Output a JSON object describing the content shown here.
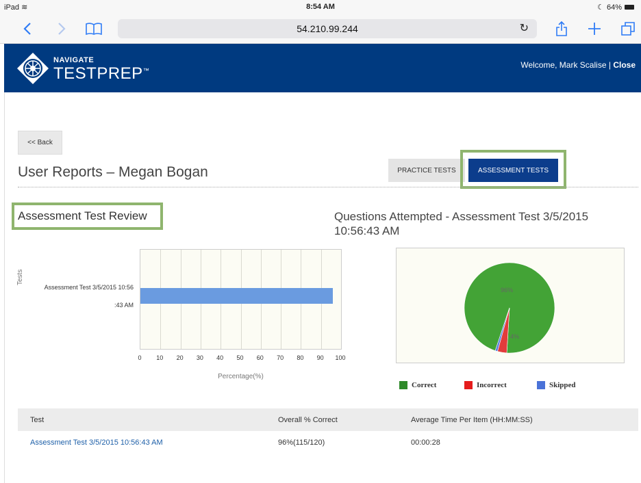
{
  "status_bar": {
    "device": "iPad",
    "time": "8:54 AM",
    "battery": "64%"
  },
  "browser": {
    "url": "54.210.99.244",
    "icons": [
      "back-icon",
      "forward-icon",
      "bookmarks-icon",
      "reload-icon",
      "share-icon",
      "new-tab-icon",
      "tabs-icon"
    ]
  },
  "header": {
    "brand_top": "NAVIGATE",
    "brand_main": "TESTPREP",
    "trademark": "™",
    "welcome": "Welcome, Mark Scalise",
    "separator": "|",
    "close_label": "Close"
  },
  "back_label": "<< Back",
  "page_title": "User Reports – Megan Bogan",
  "tabs": {
    "practice": "PRACTICE TESTS",
    "assessment": "ASSESSMENT TESTS"
  },
  "review_title": "Assessment Test Review",
  "pie_title": "Questions Attempted - Assessment Test 3/5/2015 10:56:43 AM",
  "chart_data": [
    {
      "type": "bar",
      "orientation": "horizontal",
      "categories": [
        "Assessment Test 3/5/2015 10:56:43 AM"
      ],
      "category_lines": [
        "Assessment Test 3/5/2015 10:56",
        ":43 AM"
      ],
      "values": [
        96
      ],
      "xlabel": "Percentage(%)",
      "ylabel": "Tests",
      "xlim": [
        0,
        100
      ],
      "xticks": [
        "0",
        "10",
        "20",
        "30",
        "40",
        "50",
        "60",
        "70",
        "80",
        "90",
        "100"
      ],
      "grid": true,
      "color": "#6a9be0"
    },
    {
      "type": "pie",
      "labels": [
        "Correct",
        "Incorrect",
        "Skipped"
      ],
      "values": [
        115,
        4,
        1
      ],
      "data_labels": [
        "96%",
        "4%",
        ""
      ],
      "colors": [
        "#43a336",
        "#e23c3c",
        "#5a7fe0"
      ],
      "legend": "bottom"
    }
  ],
  "legend": [
    {
      "label": "Correct",
      "color": "#2f8a2a"
    },
    {
      "label": "Incorrect",
      "color": "#e51c1c"
    },
    {
      "label": "Skipped",
      "color": "#4a72d8"
    }
  ],
  "table": {
    "headers": [
      "Test",
      "Overall % Correct",
      "Average Time Per Item (HH:MM:SS)"
    ],
    "rows": [
      [
        "Assessment Test 3/5/2015 10:56:43 AM",
        "96%(115/120)",
        "00:00:28"
      ]
    ]
  }
}
